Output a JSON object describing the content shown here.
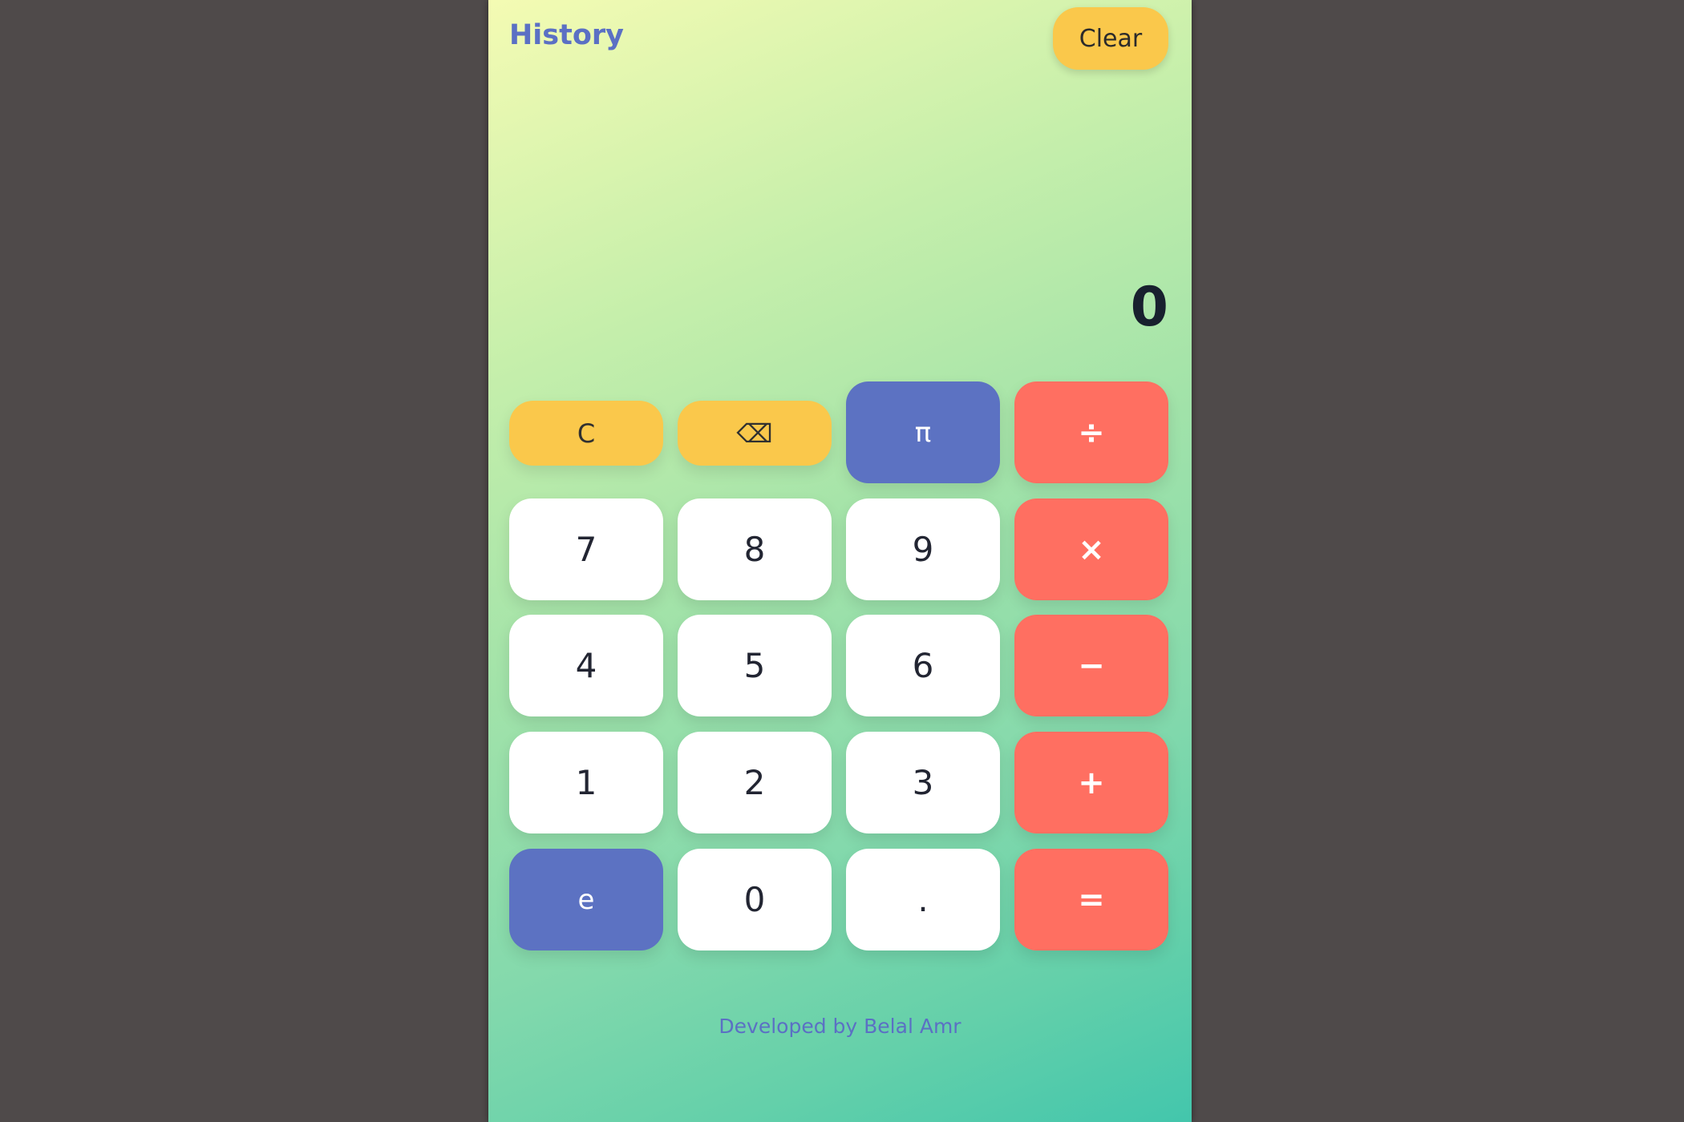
{
  "header": {
    "history_title": "History",
    "clear_label": "Clear"
  },
  "display": {
    "value": "0"
  },
  "keys": {
    "clear": "C",
    "backspace": "⌫",
    "pi": "π",
    "divide": "÷",
    "seven": "7",
    "eight": "8",
    "nine": "9",
    "multiply": "×",
    "four": "4",
    "five": "5",
    "six": "6",
    "subtract": "−",
    "one": "1",
    "two": "2",
    "three": "3",
    "add": "+",
    "euler": "e",
    "zero": "0",
    "decimal": ".",
    "equals": "="
  },
  "footer": {
    "credit": "Developed by Belal Amr"
  },
  "colors": {
    "accent_blue": "#5c72c2",
    "accent_yellow": "#fac84b",
    "accent_red": "#ff6f61",
    "key_white": "#ffffff",
    "page_background": "#4f4a4a"
  }
}
